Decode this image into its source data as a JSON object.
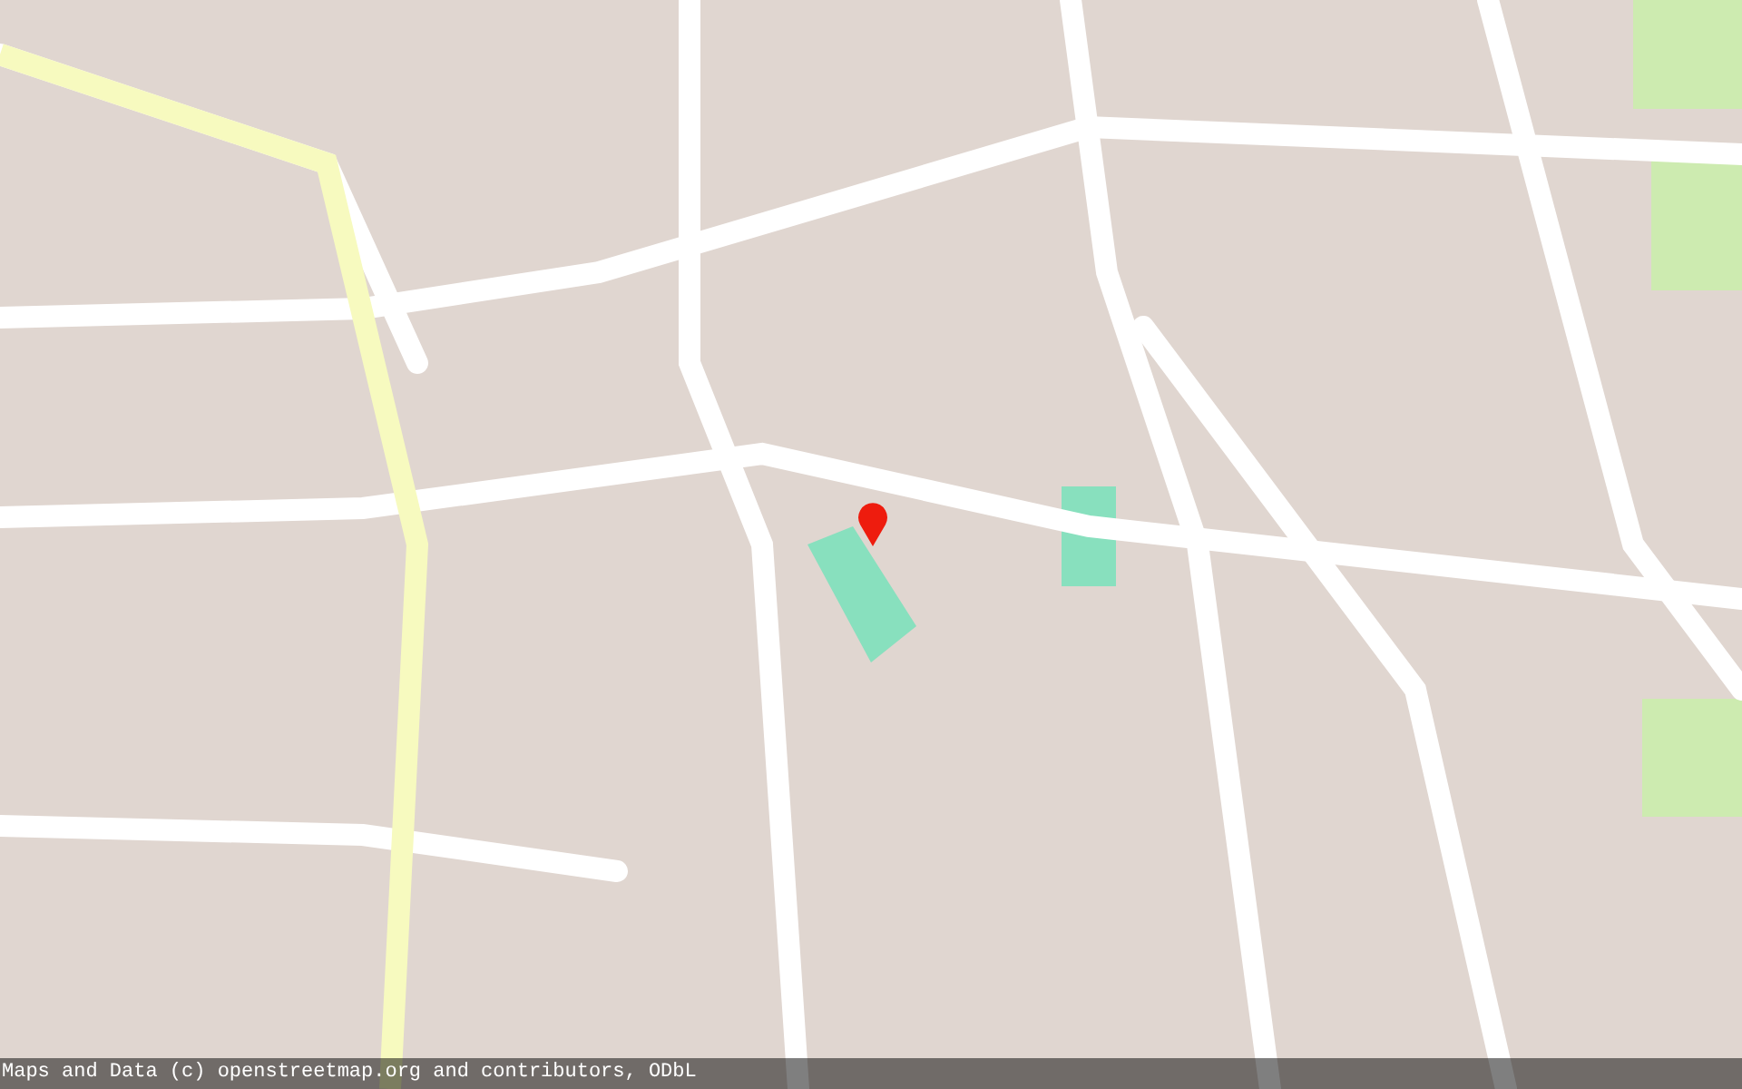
{
  "map": {
    "marker": {
      "color": "#ee1c0e"
    }
  },
  "attribution": "Maps and Data (c) openstreetmap.org and contributors, ODbL"
}
